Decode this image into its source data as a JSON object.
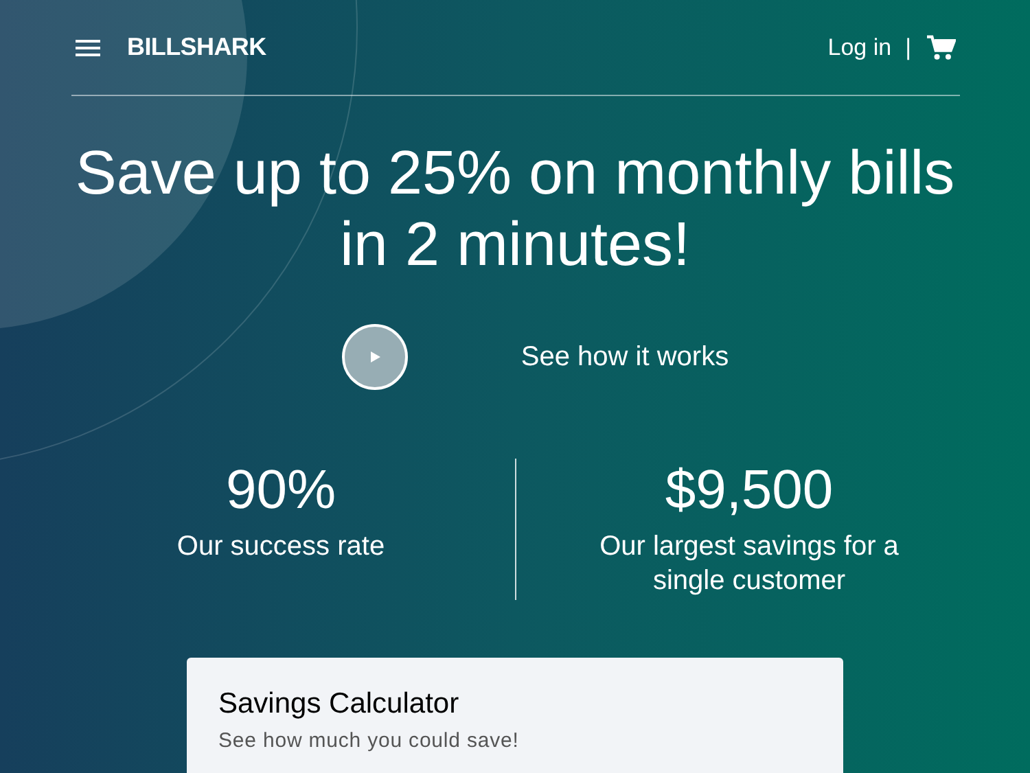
{
  "header": {
    "logo": "BILLSHARK",
    "login": "Log in",
    "separator": "|"
  },
  "headline": "Save up to 25% on monthly bills in 2 minutes!",
  "video_link": "See how it works",
  "stats": [
    {
      "value": "90%",
      "label": "Our success rate"
    },
    {
      "value": "$9,500",
      "label": "Our largest savings for a single customer"
    }
  ],
  "calculator": {
    "title": "Savings Calculator",
    "subtitle": "See how much you could save!"
  }
}
